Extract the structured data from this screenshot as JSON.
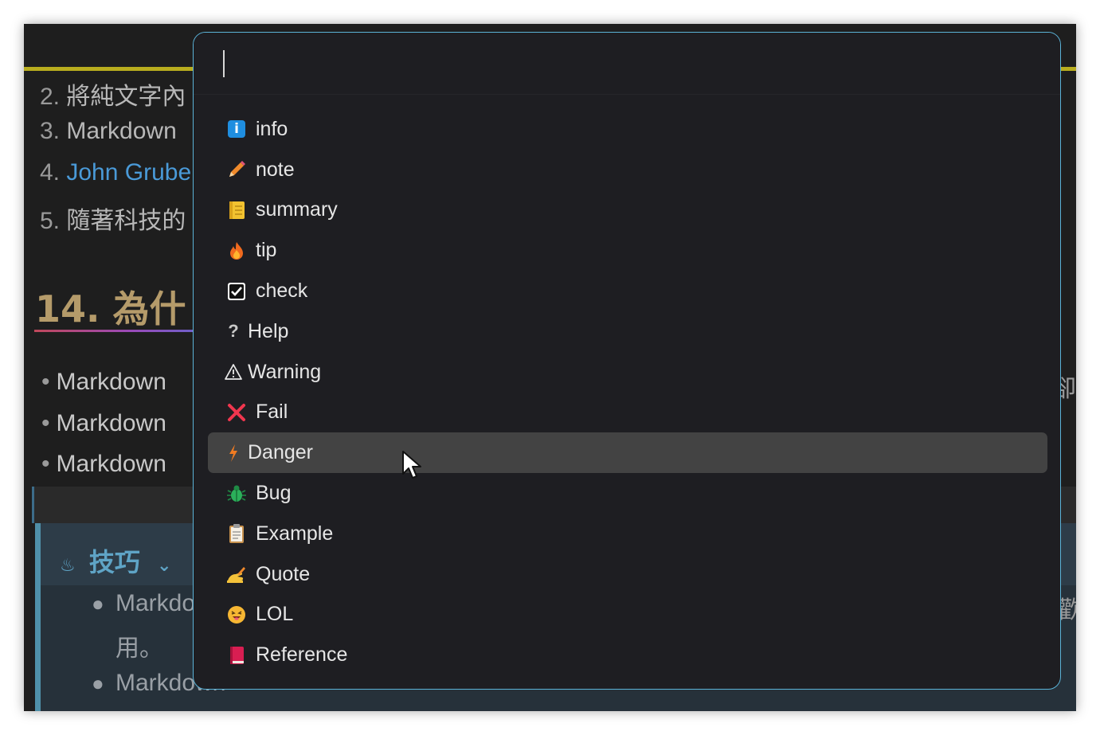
{
  "editor": {
    "ordered_list": [
      {
        "num": "2.",
        "text": "將純文字內"
      },
      {
        "num": "3.",
        "text": "Markdown"
      },
      {
        "num": "4.",
        "text": "John Grube"
      },
      {
        "num": "5.",
        "text": "隨著科技的"
      }
    ],
    "heading": "14. 為什",
    "bullets": [
      "Markdown",
      "Markdown",
      "Markdown"
    ],
    "right_clip": [
      "卻",
      "歡"
    ],
    "callout": {
      "title": "技巧",
      "lines": [
        "Markdo",
        "用。",
        "Markdown"
      ]
    }
  },
  "palette": {
    "input_value": "",
    "items": [
      {
        "label": "info",
        "icon": "info-icon"
      },
      {
        "label": "note",
        "icon": "pencil-icon"
      },
      {
        "label": "summary",
        "icon": "notebook-icon"
      },
      {
        "label": "tip",
        "icon": "fire-icon"
      },
      {
        "label": "check",
        "icon": "checkbox-icon"
      },
      {
        "label": "Help",
        "icon": "question-icon"
      },
      {
        "label": "Warning",
        "icon": "warning-icon"
      },
      {
        "label": "Fail",
        "icon": "cross-icon"
      },
      {
        "label": "Danger",
        "icon": "lightning-icon",
        "selected": true
      },
      {
        "label": "Bug",
        "icon": "bug-icon"
      },
      {
        "label": "Example",
        "icon": "clipboard-icon"
      },
      {
        "label": "Quote",
        "icon": "writing-hand-icon"
      },
      {
        "label": "LOL",
        "icon": "laughing-face-icon"
      },
      {
        "label": "Reference",
        "icon": "book-icon"
      }
    ],
    "accent_color": "#5bb3d8"
  }
}
